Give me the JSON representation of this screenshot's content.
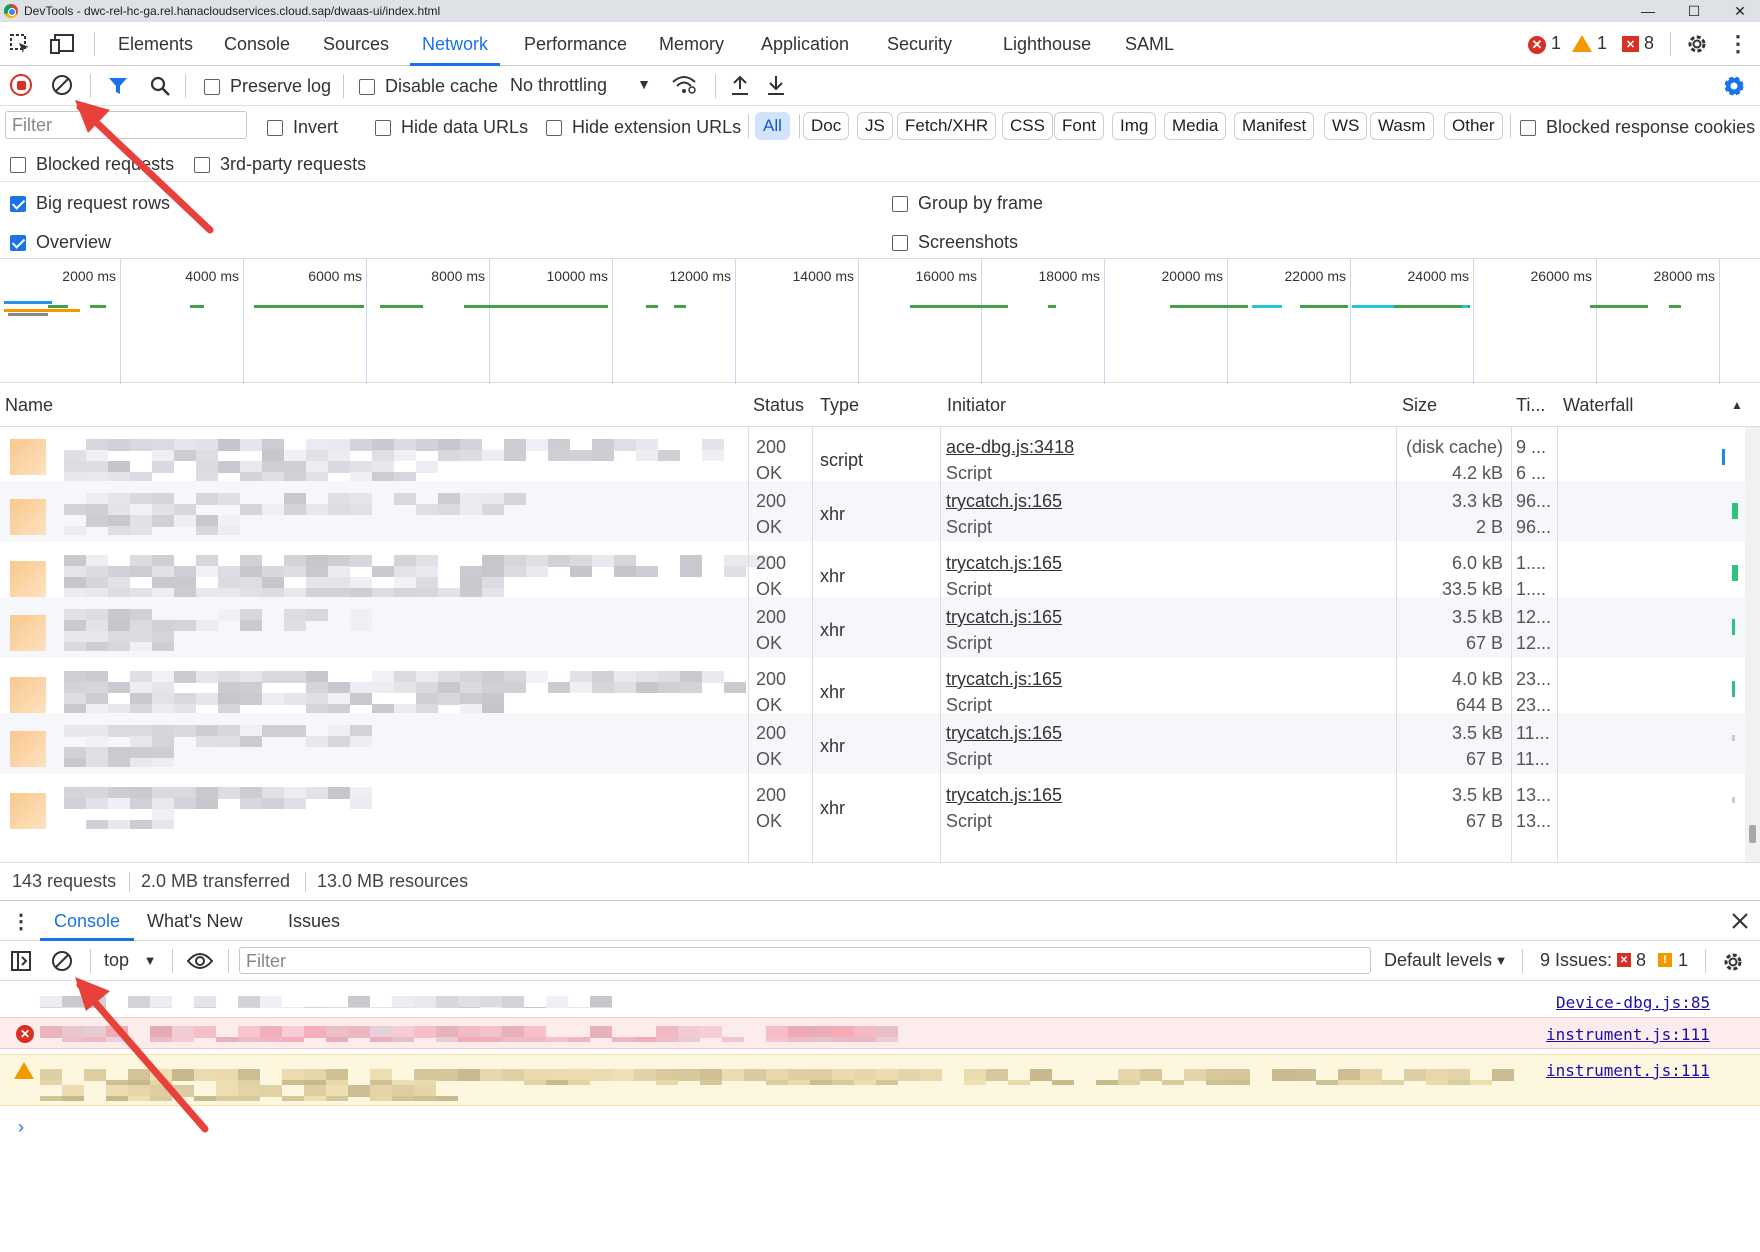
{
  "titlebar": {
    "title": "DevTools - dwc-rel-hc-ga.rel.hanacloudservices.cloud.sap/dwaas-ui/index.html",
    "min": "—",
    "max": "☐",
    "close": "✕"
  },
  "tabs": [
    "Elements",
    "Console",
    "Sources",
    "Network",
    "Performance",
    "Memory",
    "Application",
    "Security",
    "Lighthouse",
    "SAML"
  ],
  "active_tab": "Network",
  "badges": {
    "errors": "1",
    "warnings": "1",
    "issues": "8"
  },
  "toolbar": {
    "preserve_log": "Preserve log",
    "disable_cache": "Disable cache",
    "throttling": "No throttling"
  },
  "filter": {
    "placeholder": "Filter",
    "invert": "Invert",
    "hide_data": "Hide data URLs",
    "hide_ext": "Hide extension URLs",
    "chips": [
      "All",
      "Doc",
      "JS",
      "Fetch/XHR",
      "CSS",
      "Font",
      "Img",
      "Media",
      "Manifest",
      "WS",
      "Wasm",
      "Other"
    ],
    "blocked_cookies": "Blocked response cookies",
    "blocked_requests": "Blocked requests",
    "third_party": "3rd-party requests"
  },
  "settings": {
    "big_rows": "Big request rows",
    "overview": "Overview",
    "group_frame": "Group by frame",
    "screenshots": "Screenshots"
  },
  "overview_ticks": [
    "2000 ms",
    "4000 ms",
    "6000 ms",
    "8000 ms",
    "10000 ms",
    "12000 ms",
    "14000 ms",
    "16000 ms",
    "18000 ms",
    "20000 ms",
    "22000 ms",
    "24000 ms",
    "26000 ms",
    "28000 ms"
  ],
  "columns": {
    "name": "Name",
    "status": "Status",
    "type": "Type",
    "initiator": "Initiator",
    "size": "Size",
    "time": "Ti...",
    "waterfall": "Waterfall"
  },
  "rows": [
    {
      "status1": "200",
      "status2": "OK",
      "type": "script",
      "init": "ace-dbg.js:3418",
      "init2": "Script",
      "size1": "(disk cache)",
      "size2": "4.2 kB",
      "time1": "9 ...",
      "time2": "6 ..."
    },
    {
      "status1": "200",
      "status2": "OK",
      "type": "xhr",
      "init": "trycatch.js:165",
      "init2": "Script",
      "size1": "3.3 kB",
      "size2": "2 B",
      "time1": "96...",
      "time2": "96..."
    },
    {
      "status1": "200",
      "status2": "OK",
      "type": "xhr",
      "init": "trycatch.js:165",
      "init2": "Script",
      "size1": "6.0 kB",
      "size2": "33.5 kB",
      "time1": "1....",
      "time2": "1...."
    },
    {
      "status1": "200",
      "status2": "OK",
      "type": "xhr",
      "init": "trycatch.js:165",
      "init2": "Script",
      "size1": "3.5 kB",
      "size2": "67 B",
      "time1": "12...",
      "time2": "12..."
    },
    {
      "status1": "200",
      "status2": "OK",
      "type": "xhr",
      "init": "trycatch.js:165",
      "init2": "Script",
      "size1": "4.0 kB",
      "size2": "644 B",
      "time1": "23...",
      "time2": "23..."
    },
    {
      "status1": "200",
      "status2": "OK",
      "type": "xhr",
      "init": "trycatch.js:165",
      "init2": "Script",
      "size1": "3.5 kB",
      "size2": "67 B",
      "time1": "11...",
      "time2": "11..."
    },
    {
      "status1": "200",
      "status2": "OK",
      "type": "xhr",
      "init": "trycatch.js:165",
      "init2": "Script",
      "size1": "3.5 kB",
      "size2": "67 B",
      "time1": "13...",
      "time2": "13..."
    }
  ],
  "summary": {
    "requests": "143 requests",
    "transferred": "2.0 MB transferred",
    "resources": "13.0 MB resources"
  },
  "drawer_tabs": [
    "Console",
    "What's New",
    "Issues"
  ],
  "console_toolbar": {
    "context": "top",
    "filter_placeholder": "Filter",
    "levels": "Default levels",
    "issues_label": "9 Issues:",
    "issues_err": "8",
    "issues_warn": "1"
  },
  "console_msgs": [
    {
      "src": "Device-dbg.js:85"
    },
    {
      "src": "instrument.js:111"
    },
    {
      "src": "instrument.js:111"
    }
  ],
  "colors": {
    "accent": "#1a73e8",
    "error": "#d93025",
    "warning": "#f29900",
    "arrow": "#e8403a"
  }
}
